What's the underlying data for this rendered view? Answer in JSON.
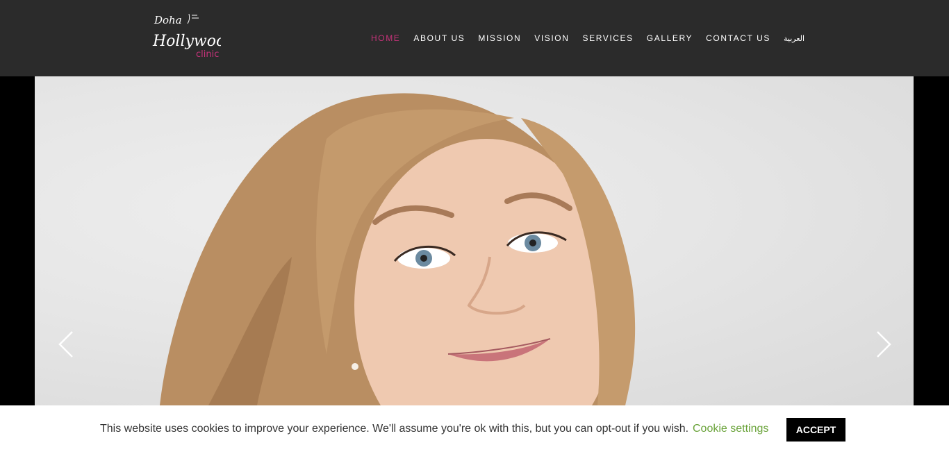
{
  "logo": {
    "line1": "Doha",
    "line2": "Hollywood",
    "line3": "clinic"
  },
  "nav": {
    "items": [
      {
        "label": "HOME",
        "active": true
      },
      {
        "label": "ABOUT US"
      },
      {
        "label": "MISSION"
      },
      {
        "label": "VISION"
      },
      {
        "label": "SERVICES"
      },
      {
        "label": "GALLERY"
      },
      {
        "label": "CONTACT US"
      },
      {
        "label": "العربية"
      }
    ]
  },
  "colors": {
    "header_bg": "#2b2b2b",
    "accent": "#c8337b",
    "cookie_link": "#6aa33a",
    "accept_bg": "#000000"
  },
  "slider": {
    "prev_icon": "chevron-left-icon",
    "next_icon": "chevron-right-icon"
  },
  "cookie": {
    "text": "This website uses cookies to improve your experience. We'll assume you're ok with this, but you can opt-out if you wish.",
    "settings_label": "Cookie settings",
    "accept_label": "ACCEPT"
  }
}
